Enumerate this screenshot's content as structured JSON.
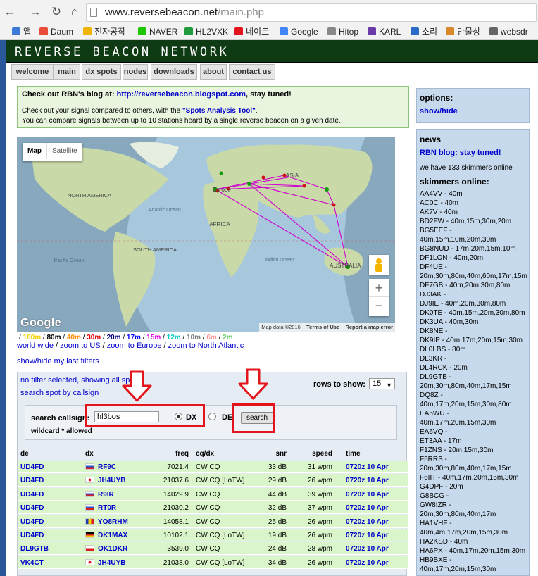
{
  "browser": {
    "url_host": "www.reversebeacon.net",
    "url_path": "/main.php",
    "bookmarks": [
      "앱",
      "Daum",
      "전자공작",
      "NAVER",
      "HL2VXK",
      "네이트",
      "Google",
      "Hitop",
      "KARL",
      "소리",
      "만물상",
      "websdr"
    ],
    "bookmark_colors": [
      "#3b7ad9",
      "#e94b3b",
      "#f0b400",
      "#1ec800",
      "#1f9b3e",
      "#e3141b",
      "#4285f4",
      "#888888",
      "#6a3aa8",
      "#2b6cc4",
      "#d9882b",
      "#666666"
    ]
  },
  "site": {
    "title": "REVERSE BEACON NETWORK",
    "tabs": [
      "welcome",
      "main",
      "dx spots",
      "nodes",
      "downloads",
      "about",
      "contact us"
    ]
  },
  "blog": {
    "line1_prefix": "Check out RBN's blog at:",
    "line1_link": "http://reversebeacon.blogspot.com",
    "line1_suffix": ", stay tuned!",
    "line2_prefix": "Check out your signal compared to others, with the",
    "line2_link": "\"Spots Analysis Tool\"",
    "line2_suffix": ".",
    "line3": "You can compare signals between up to 10 stations heard by a single reverse beacon on a given date."
  },
  "map": {
    "type_map": "Map",
    "type_satellite": "Satellite",
    "labels": {
      "asia": "ASIA",
      "europe": "Europe",
      "north_america": "NORTH AMERICA",
      "atlantic": "Atlantic Ocean",
      "africa": "AFRICA",
      "south_america": "SOUTH AMERICA",
      "pacific": "Pacific Ocean",
      "indian": "Indian Ocean",
      "australia": "AUSTRALIA"
    },
    "google": "Google",
    "footer": [
      "Map data ©2016",
      "Terms of Use",
      "Report a map error"
    ],
    "zoom_in": "+",
    "zoom_out": "−"
  },
  "bands": [
    {
      "label": "160m",
      "color": "#f0d000"
    },
    {
      "label": "80m",
      "color": "#000000"
    },
    {
      "label": "40m",
      "color": "#ff8c00"
    },
    {
      "label": "30m",
      "color": "#e00000"
    },
    {
      "label": "20m",
      "color": "#000080"
    },
    {
      "label": "17m",
      "color": "#0000ff"
    },
    {
      "label": "15m",
      "color": "#e600e6"
    },
    {
      "label": "12m",
      "color": "#00cccc"
    },
    {
      "label": "10m",
      "color": "#808080"
    },
    {
      "label": "6m",
      "color": "#ff9999"
    },
    {
      "label": "2m",
      "color": "#66cc66"
    }
  ],
  "zoom_links": [
    "world wide",
    "zoom to US",
    "zoom to Europe",
    "zoom to North Atlantic"
  ],
  "my_filters": "show/hide my last filters",
  "spots": {
    "no_filter": "no filter selected, showing all spots",
    "search_by_callsign": "search spot by callsign",
    "rows_to_show_label": "rows to show:",
    "rows_to_show_value": "15",
    "search_label": "search callsign:",
    "search_value": "hl3bos",
    "radio_dx": "DX",
    "radio_de": "DE",
    "search_button": "search",
    "wildcard": "wildcard * allowed",
    "columns": [
      "de",
      "dx",
      "freq",
      "cq/dx",
      "snr",
      "speed",
      "time"
    ],
    "rows": [
      {
        "de": "UD4FD",
        "flag": "ru",
        "dx": "RF9C",
        "freq": "7021.4",
        "mode": "CW CQ",
        "snr": "33 dB",
        "speed": "31 wpm",
        "time": "0720z 10 Apr"
      },
      {
        "de": "UD4FD",
        "flag": "jp",
        "dx": "JH4UYB",
        "freq": "21037.6",
        "mode": "CW CQ [LoTW]",
        "snr": "29 dB",
        "speed": "26 wpm",
        "time": "0720z 10 Apr"
      },
      {
        "de": "UD4FD",
        "flag": "ru",
        "dx": "R9IR",
        "freq": "14029.9",
        "mode": "CW CQ",
        "snr": "44 dB",
        "speed": "39 wpm",
        "time": "0720z 10 Apr"
      },
      {
        "de": "UD4FD",
        "flag": "ru",
        "dx": "RT0R",
        "freq": "21030.2",
        "mode": "CW CQ",
        "snr": "32 dB",
        "speed": "37 wpm",
        "time": "0720z 10 Apr"
      },
      {
        "de": "UD4FD",
        "flag": "ro",
        "dx": "YO8RHM",
        "freq": "14058.1",
        "mode": "CW CQ",
        "snr": "25 dB",
        "speed": "26 wpm",
        "time": "0720z 10 Apr"
      },
      {
        "de": "UD4FD",
        "flag": "de",
        "dx": "DK1MAX",
        "freq": "10102.1",
        "mode": "CW CQ [LoTW]",
        "snr": "19 dB",
        "speed": "26 wpm",
        "time": "0720z 10 Apr"
      },
      {
        "de": "DL9GTB",
        "flag": "cz",
        "dx": "OK1DKR",
        "freq": "3539.0",
        "mode": "CW CQ",
        "snr": "24 dB",
        "speed": "28 wpm",
        "time": "0720z 10 Apr"
      },
      {
        "de": "VK4CT",
        "flag": "jp",
        "dx": "JH4UYB",
        "freq": "21038.0",
        "mode": "CW CQ [LoTW]",
        "snr": "34 dB",
        "speed": "26 wpm",
        "time": "0720z 10 Apr"
      }
    ]
  },
  "sidebar": {
    "options_title": "options:",
    "options_link": "show/hide",
    "news_title": "news",
    "blog_link": "RBN blog: stay tuned!",
    "count": "we have 133 skimmers online",
    "skimmers_title": "skimmers online:",
    "skimmers": [
      "AA4VV - 40m",
      "AC0C - 40m",
      "AK7V - 40m",
      "BD2FW - 40m,15m,30m,20m",
      "BG5EEF -",
      "40m,15m,10m,20m,30m",
      "BG8NUD - 17m,20m,15m,10m",
      "DF1LON - 40m,20m",
      "DF4UE -",
      "20m,30m,80m,40m,60m,17m,15m",
      "DF7GB - 40m,20m,30m,80m",
      "DJ3AK -",
      "DJ9IE - 40m,20m,30m,80m",
      "DK0TE - 40m,15m,20m,30m,80m",
      "DK3UA - 40m,30m",
      "DK8NE -",
      "DK9IP - 40m,17m,20m,15m,30m",
      "DL0LBS - 80m",
      "DL3KR -",
      "DL4RCK - 20m",
      "DL9GTB -",
      "20m,30m,80m,40m,17m,15m",
      "DQ8Z -",
      "40m,17m,20m,15m,30m,80m",
      "EA5WU -",
      "40m,17m,20m,15m,30m",
      "EA6VQ -",
      "ET3AA - 17m",
      "F1ZNS - 20m,15m,30m",
      "F5RRS -",
      "20m,30m,80m,40m,17m,15m",
      "F6IIT - 40m,17m,20m,15m,30m",
      "G4DPF - 20m",
      "G8BCG -",
      "GW8IZR -",
      "20m,30m,80m,40m,17m",
      "HA1VHF -",
      "40m,4m,17m,20m,15m,30m",
      "HA2KSD - 40m",
      "HA6PX - 40m,17m,20m,15m,30m",
      "HB9BXE -",
      "40m,17m,20m,15m,30m"
    ]
  },
  "colors": {
    "rbn_green": "#0e3a14",
    "spot_row": "#d9f5c9",
    "link": "#0000cc",
    "annotation_red": "#e3141b"
  }
}
